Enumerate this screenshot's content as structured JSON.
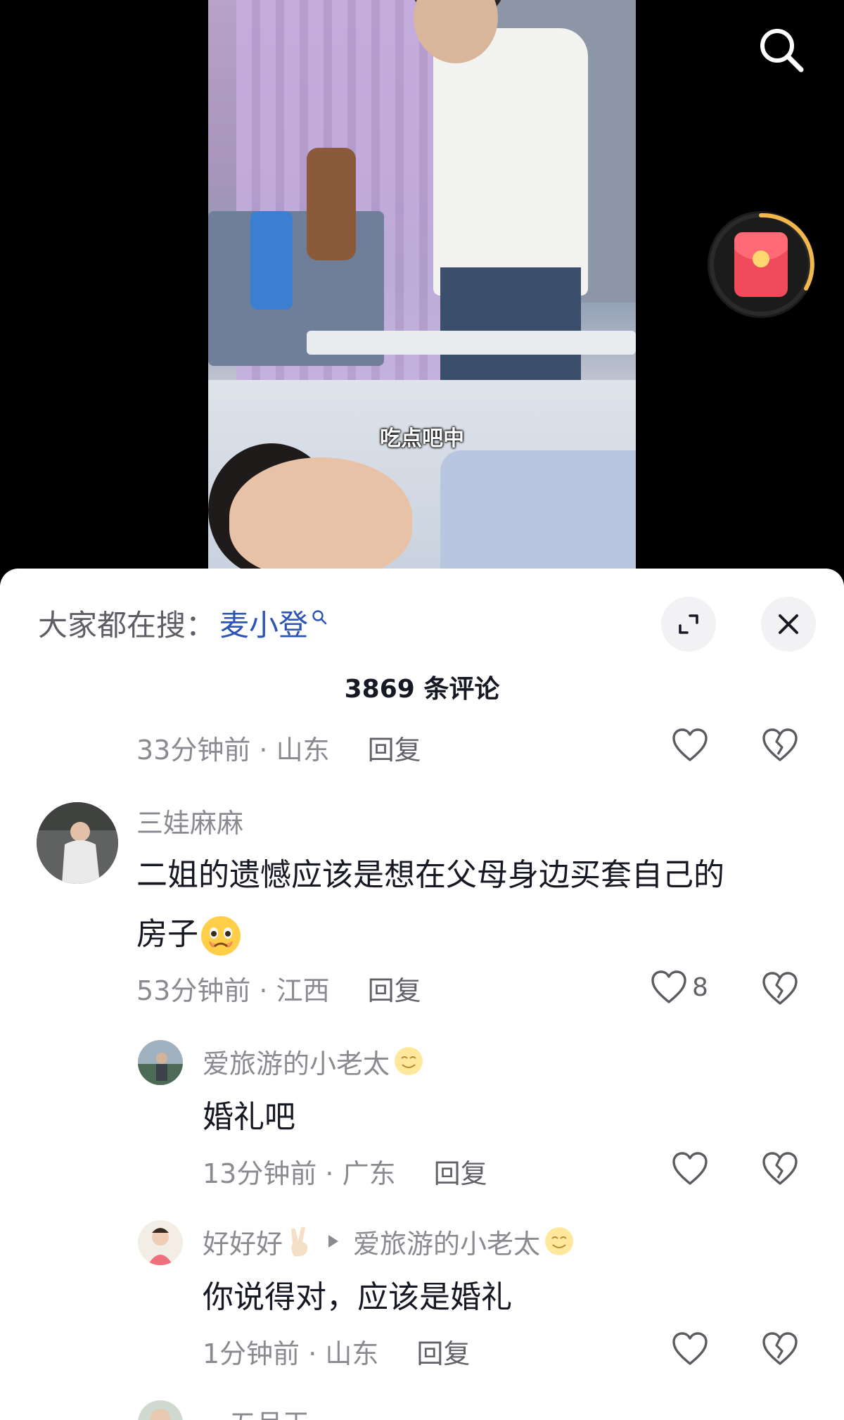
{
  "video": {
    "subtitle": "吃点吧中"
  },
  "icons": {
    "top_search": "search-icon",
    "red_packet": "red-packet-icon",
    "expand": "expand-icon",
    "close": "close-icon",
    "like": "heart-icon",
    "dislike": "broken-heart-icon"
  },
  "comments_panel": {
    "search_prefix": "大家都在搜：",
    "search_term": "麦小登",
    "count_title": "3869 条评论"
  },
  "comments": [
    {
      "time_loc": "33分钟前 · 山东",
      "reply": "回复"
    },
    {
      "user": "三娃麻麻",
      "text_line1": "二姐的遗憾应该是想在父母身边买套自己的",
      "text_line2": "房子",
      "emoji": "crying-face-emoji",
      "time_loc": "53分钟前 · 江西",
      "reply": "回复",
      "likes": "8"
    },
    {
      "user": "爱旅游的小老太",
      "emoji": "smiling-face-emoji",
      "text": "婚礼吧",
      "time_loc": "13分钟前 · 广东",
      "reply": "回复"
    },
    {
      "user": "好好好",
      "emoji": "victory-hand-emoji",
      "reply_to": "爱旅游的小老太",
      "reply_to_emoji": "smiling-face-emoji",
      "text": "你说得对，应该是婚礼",
      "time_loc": "1分钟前 · 山东",
      "reply": "回复"
    },
    {
      "user_partial": "一五月王"
    }
  ],
  "colors": {
    "accent_link": "#2c54b8",
    "red_packet": "#f04b5a",
    "ring": "#f2b84b"
  }
}
